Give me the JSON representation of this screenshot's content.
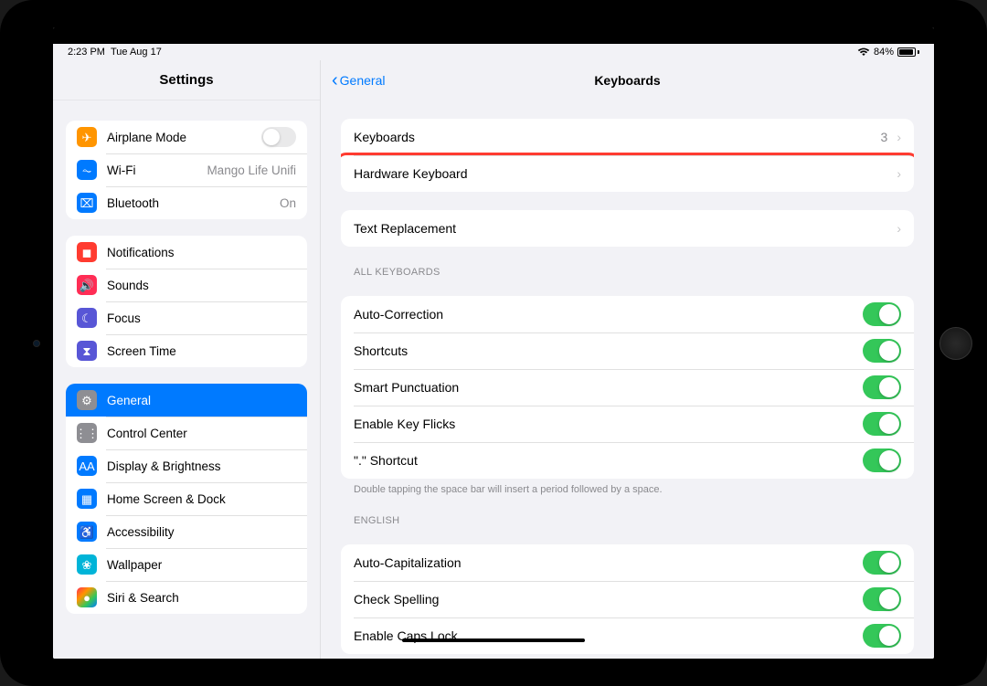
{
  "statusbar": {
    "time": "2:23 PM",
    "date": "Tue Aug 17",
    "battery_pct": "84%"
  },
  "sidebar": {
    "title": "Settings",
    "groups": [
      {
        "rows": [
          {
            "icon": "airplane-icon",
            "label": "Airplane Mode",
            "type": "switch"
          },
          {
            "icon": "wifi-icon",
            "label": "Wi-Fi",
            "detail": "Mango Life Unifi"
          },
          {
            "icon": "bluetooth-icon",
            "label": "Bluetooth",
            "detail": "On"
          }
        ]
      },
      {
        "rows": [
          {
            "icon": "notifications-icon",
            "label": "Notifications"
          },
          {
            "icon": "sounds-icon",
            "label": "Sounds"
          },
          {
            "icon": "focus-icon",
            "label": "Focus"
          },
          {
            "icon": "screentime-icon",
            "label": "Screen Time"
          }
        ]
      },
      {
        "rows": [
          {
            "icon": "general-icon",
            "label": "General",
            "selected": true
          },
          {
            "icon": "controlcenter-icon",
            "label": "Control Center"
          },
          {
            "icon": "display-icon",
            "label": "Display & Brightness"
          },
          {
            "icon": "homescreen-icon",
            "label": "Home Screen & Dock"
          },
          {
            "icon": "accessibility-icon",
            "label": "Accessibility"
          },
          {
            "icon": "wallpaper-icon",
            "label": "Wallpaper"
          },
          {
            "icon": "siri-icon",
            "label": "Siri & Search"
          }
        ]
      }
    ]
  },
  "main": {
    "back": "General",
    "title": "Keyboards",
    "sections": [
      {
        "rows": [
          {
            "label": "Keyboards",
            "detail": "3",
            "disclosure": true
          },
          {
            "label": "Hardware Keyboard",
            "disclosure": true,
            "highlight": true
          }
        ]
      },
      {
        "rows": [
          {
            "label": "Text Replacement",
            "disclosure": true
          }
        ]
      },
      {
        "header": "ALL KEYBOARDS",
        "rows": [
          {
            "label": "Auto-Correction",
            "toggle": true
          },
          {
            "label": "Shortcuts",
            "toggle": true
          },
          {
            "label": "Smart Punctuation",
            "toggle": true
          },
          {
            "label": "Enable Key Flicks",
            "toggle": true
          },
          {
            "label": "\".\" Shortcut",
            "toggle": true
          }
        ],
        "footer": "Double tapping the space bar will insert a period followed by a space."
      },
      {
        "header": "ENGLISH",
        "rows": [
          {
            "label": "Auto-Capitalization",
            "toggle": true
          },
          {
            "label": "Check Spelling",
            "toggle": true
          },
          {
            "label": "Enable Caps Lock",
            "toggle": true
          }
        ]
      }
    ]
  }
}
